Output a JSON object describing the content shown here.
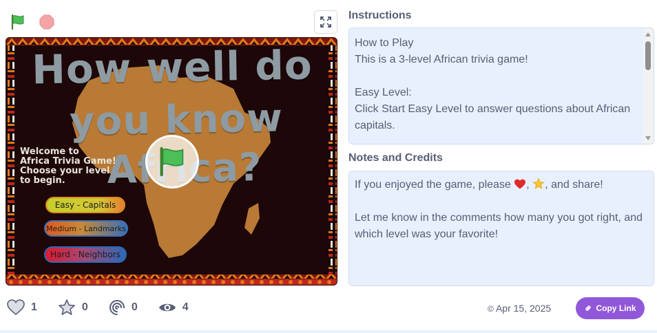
{
  "player": {
    "green_flag_icon": "green-flag-icon",
    "stop_icon": "stop-sign-icon",
    "fullscreen_icon": "fullscreen-icon"
  },
  "stage": {
    "title_lines": [
      "How well do",
      "you know",
      "Africa?"
    ],
    "welcome_text": "Welcome to\nAfrica Trivia Game!\nChoose your level\nto begin.",
    "buttons": {
      "easy": "Easy - Capitals",
      "medium": "Medium - Landmarks",
      "hard": "Hard - Neighbors"
    },
    "colors": {
      "background": "#1d0708",
      "continent": "#b87a35",
      "title_text": "#8e9ba3",
      "pattern_orange": "#e2781b",
      "pattern_red": "#c0261e"
    }
  },
  "stats": {
    "loves": "1",
    "favorites": "0",
    "remixes": "0",
    "views": "4"
  },
  "date": "Apr 15, 2025",
  "copy_link_label": "Copy Link",
  "instructions": {
    "title": "Instructions",
    "text": "How to Play\nThis is a 3-level African trivia game!\n\nEasy Level:\nClick Start Easy Level to answer questions about African capitals."
  },
  "notes": {
    "title": "Notes and Credits",
    "line1_prefix": "If you enjoyed the game, please",
    "line1_sep": ",",
    "line1_suffix": ", and share!",
    "paragraph2": "Let me know in the comments how many you got right, and which level was your favorite!"
  },
  "colors": {
    "accent": "#9157d9",
    "info_bg": "#e8f0fd",
    "text": "#575e75"
  }
}
